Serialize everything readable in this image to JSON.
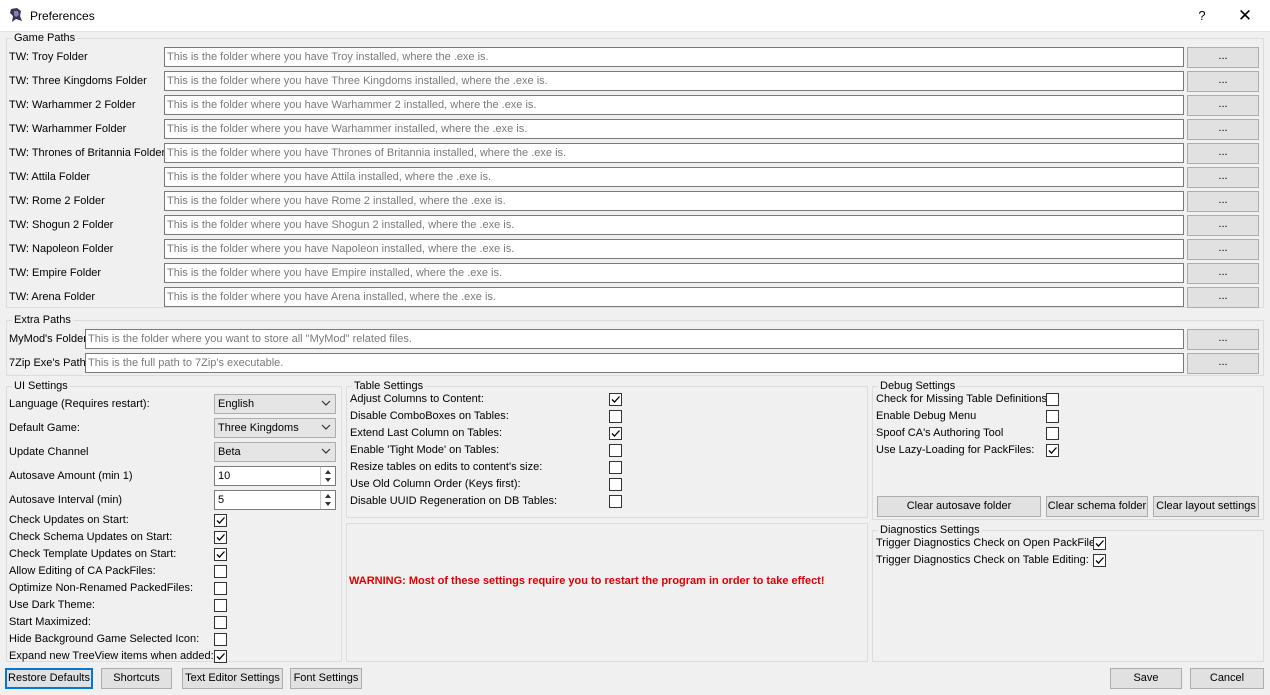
{
  "window": {
    "title": "Preferences",
    "help_glyph": "?",
    "close_glyph": "✕",
    "icon": "app-logo-icon"
  },
  "game_paths": {
    "title": "Game Paths",
    "browse_label": "...",
    "rows": [
      {
        "label": "TW: Troy Folder",
        "placeholder": "This is the folder where you have Troy installed, where the .exe is."
      },
      {
        "label": "TW: Three Kingdoms Folder",
        "placeholder": "This is the folder where you have Three Kingdoms installed, where the .exe is."
      },
      {
        "label": "TW: Warhammer 2 Folder",
        "placeholder": "This is the folder where you have Warhammer 2 installed, where the .exe is."
      },
      {
        "label": "TW: Warhammer Folder",
        "placeholder": "This is the folder where you have Warhammer installed, where the .exe is."
      },
      {
        "label": "TW: Thrones of Britannia Folder",
        "placeholder": "This is the folder where you have Thrones of Britannia installed, where the .exe is."
      },
      {
        "label": "TW: Attila Folder",
        "placeholder": "This is the folder where you have Attila installed, where the .exe is."
      },
      {
        "label": "TW: Rome 2 Folder",
        "placeholder": "This is the folder where you have Rome 2 installed, where the .exe is."
      },
      {
        "label": "TW: Shogun 2 Folder",
        "placeholder": "This is the folder where you have Shogun 2 installed, where the .exe is."
      },
      {
        "label": "TW: Napoleon Folder",
        "placeholder": "This is the folder where you have Napoleon installed, where the .exe is."
      },
      {
        "label": "TW: Empire Folder",
        "placeholder": "This is the folder where you have Empire installed, where the .exe is."
      },
      {
        "label": "TW: Arena Folder",
        "placeholder": "This is the folder where you have Arena installed, where the .exe is."
      }
    ]
  },
  "extra_paths": {
    "title": "Extra Paths",
    "browse_label": "...",
    "rows": [
      {
        "label": "MyMod's Folder",
        "placeholder": "This is the folder where you want to store all \"MyMod\" related files."
      },
      {
        "label": "7Zip Exe's Path",
        "placeholder": "This is the full path to 7Zip's executable."
      }
    ]
  },
  "ui_settings": {
    "title": "UI Settings",
    "language": {
      "label": "Language (Requires restart):",
      "value": "English"
    },
    "default_game": {
      "label": "Default Game:",
      "value": "Three Kingdoms"
    },
    "update_channel": {
      "label": "Update Channel",
      "value": "Beta"
    },
    "autosave_amount": {
      "label": "Autosave Amount (min 1)",
      "value": "10"
    },
    "autosave_interval": {
      "label": "Autosave Interval (min)",
      "value": "5"
    },
    "checks": [
      {
        "label": "Check Updates on Start:",
        "checked": true
      },
      {
        "label": "Check Schema Updates on Start:",
        "checked": true
      },
      {
        "label": "Check Template Updates on Start:",
        "checked": true
      },
      {
        "label": "Allow Editing of CA PackFiles:",
        "checked": false
      },
      {
        "label": "Optimize Non-Renamed PackedFiles:",
        "checked": false
      },
      {
        "label": "Use Dark Theme:",
        "checked": false
      },
      {
        "label": "Start Maximized:",
        "checked": false
      },
      {
        "label": "Hide Background Game Selected Icon:",
        "checked": false
      },
      {
        "label": "Expand new TreeView items when added:",
        "checked": true
      }
    ]
  },
  "table_settings": {
    "title": "Table Settings",
    "checks": [
      {
        "label": "Adjust Columns to Content:",
        "checked": true
      },
      {
        "label": "Disable ComboBoxes on Tables:",
        "checked": false
      },
      {
        "label": "Extend Last Column on Tables:",
        "checked": true
      },
      {
        "label": "Enable 'Tight Mode' on Tables:",
        "checked": false
      },
      {
        "label": "Resize tables on edits to content's size:",
        "checked": false
      },
      {
        "label": "Use Old Column Order (Keys first):",
        "checked": false
      },
      {
        "label": "Disable UUID Regeneration on DB Tables:",
        "checked": false
      }
    ]
  },
  "warning": "WARNING: Most of these settings require you to restart the program in order to take effect!",
  "debug_settings": {
    "title": "Debug Settings",
    "checks": [
      {
        "label": "Check for Missing Table Definitions",
        "checked": false
      },
      {
        "label": "Enable Debug Menu",
        "checked": false
      },
      {
        "label": "Spoof CA's Authoring Tool",
        "checked": false
      },
      {
        "label": "Use Lazy-Loading for PackFiles:",
        "checked": true
      }
    ],
    "buttons": {
      "clear_autosave": "Clear autosave folder",
      "clear_schema": "Clear schema folder",
      "clear_layout": "Clear layout settings"
    }
  },
  "diagnostics_settings": {
    "title": "Diagnostics Settings",
    "checks": [
      {
        "label": "Trigger Diagnostics Check on Open PackFile:",
        "checked": true
      },
      {
        "label": "Trigger Diagnostics Check on Table Editing:",
        "checked": true
      }
    ]
  },
  "footer": {
    "restore_defaults": "Restore Defaults",
    "shortcuts": "Shortcuts",
    "text_editor_settings": "Text Editor Settings",
    "font_settings": "Font Settings",
    "save": "Save",
    "cancel": "Cancel"
  }
}
